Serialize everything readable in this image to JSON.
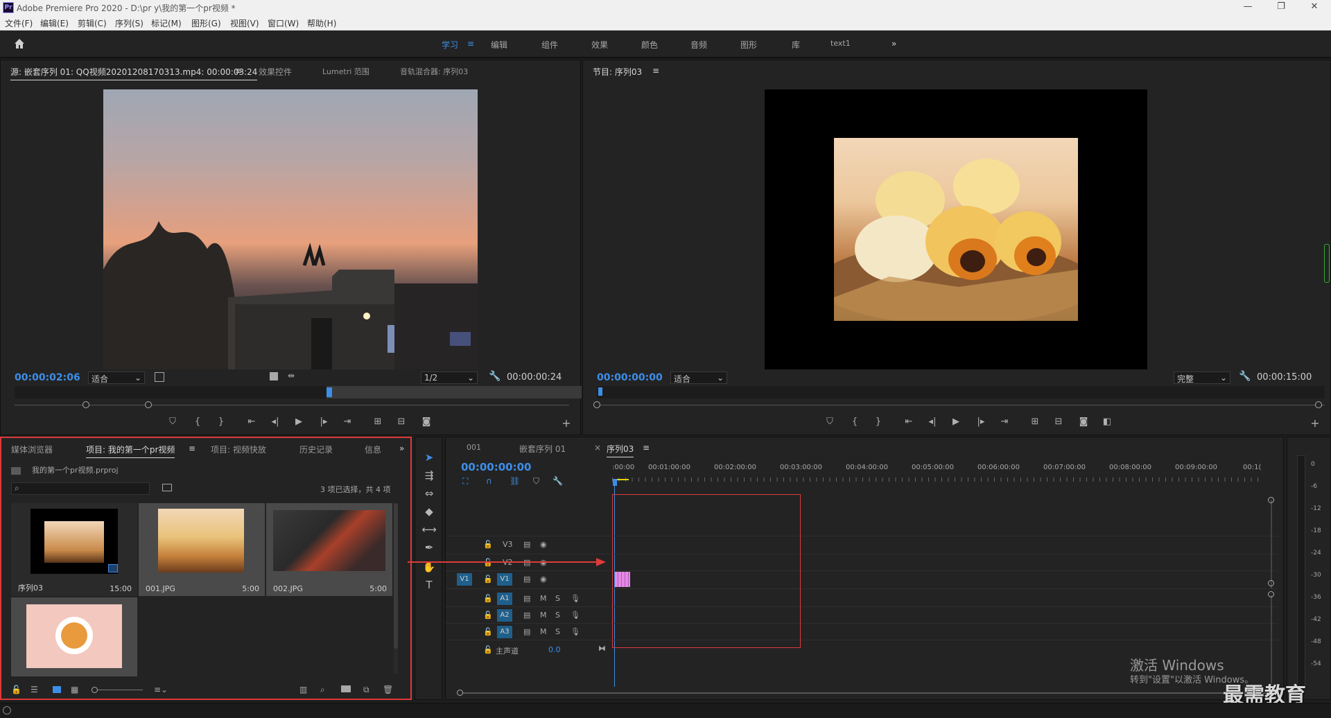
{
  "app": {
    "title": "Adobe Premiere Pro 2020 - D:\\pr y\\我的第一个pr视频 *",
    "logo": "Pr",
    "window_controls": [
      "—",
      "❐",
      "✕"
    ]
  },
  "menu": [
    "文件(F)",
    "编辑(E)",
    "剪辑(C)",
    "序列(S)",
    "标记(M)",
    "图形(G)",
    "视图(V)",
    "窗口(W)",
    "帮助(H)"
  ],
  "workspaces": [
    "学习",
    "编辑",
    "组件",
    "效果",
    "颜色",
    "音频",
    "图形",
    "库",
    "text1"
  ],
  "workspace_active_index": 0,
  "source_panel": {
    "tabs": [
      "源: 嵌套序列 01: QQ视频20201208170313.mp4: 00:00:03:24",
      "效果控件",
      "Lumetri 范围",
      "音轨混合器: 序列03"
    ],
    "timecode": "00:00:02:06",
    "fit": "适合",
    "resolution": "1/2",
    "duration": "00:00:00:24"
  },
  "program_panel": {
    "tab": "节目: 序列03",
    "timecode": "00:00:00:00",
    "fit": "适合",
    "quality": "完整",
    "duration": "00:00:15:00"
  },
  "project_panel": {
    "tabs": [
      "媒体浏览器",
      "项目: 我的第一个pr视频",
      "项目: 视频快放",
      "历史记录",
      "信息"
    ],
    "project_file": "我的第一个pr视频.prproj",
    "search_placeholder": "",
    "selection_info": "3 项已选择，共 4 项",
    "items": [
      {
        "name": "序列03",
        "duration": "15:00"
      },
      {
        "name": "001.JPG",
        "duration": "5:00"
      },
      {
        "name": "002.JPG",
        "duration": "5:00"
      },
      {
        "name": "",
        "duration": ""
      }
    ]
  },
  "timeline": {
    "tabs": [
      "001",
      "嵌套序列 01",
      "序列03"
    ],
    "timecode": "00:00:00:00",
    "ruler": [
      ":00:00",
      "00:01:00:00",
      "00:02:00:00",
      "00:03:00:00",
      "00:04:00:00",
      "00:05:00:00",
      "00:06:00:00",
      "00:07:00:00",
      "00:08:00:00",
      "00:09:00:00",
      "00:1("
    ],
    "video_tracks": [
      "V3",
      "V2",
      "V1"
    ],
    "source_patch": "V1",
    "audio_tracks": [
      "A1",
      "A2",
      "A3"
    ],
    "master": {
      "label": "主声道",
      "value": "0.0"
    },
    "m_label": "M",
    "s_label": "S"
  },
  "meter": {
    "scale": [
      "0",
      "-6",
      "-12",
      "-18",
      "-24",
      "-30",
      "-36",
      "-42",
      "-48",
      "-54"
    ]
  },
  "watermark": {
    "activate_title": "激活 Windows",
    "activate_sub": "转到\"设置\"以激活 Windows。",
    "brand": "最需教育"
  },
  "colors": {
    "accent_blue": "#3d8ee8",
    "annotation_red": "#e03a3a",
    "clip_pink": "#e48ae6",
    "track_blue": "#1f5f8b"
  }
}
